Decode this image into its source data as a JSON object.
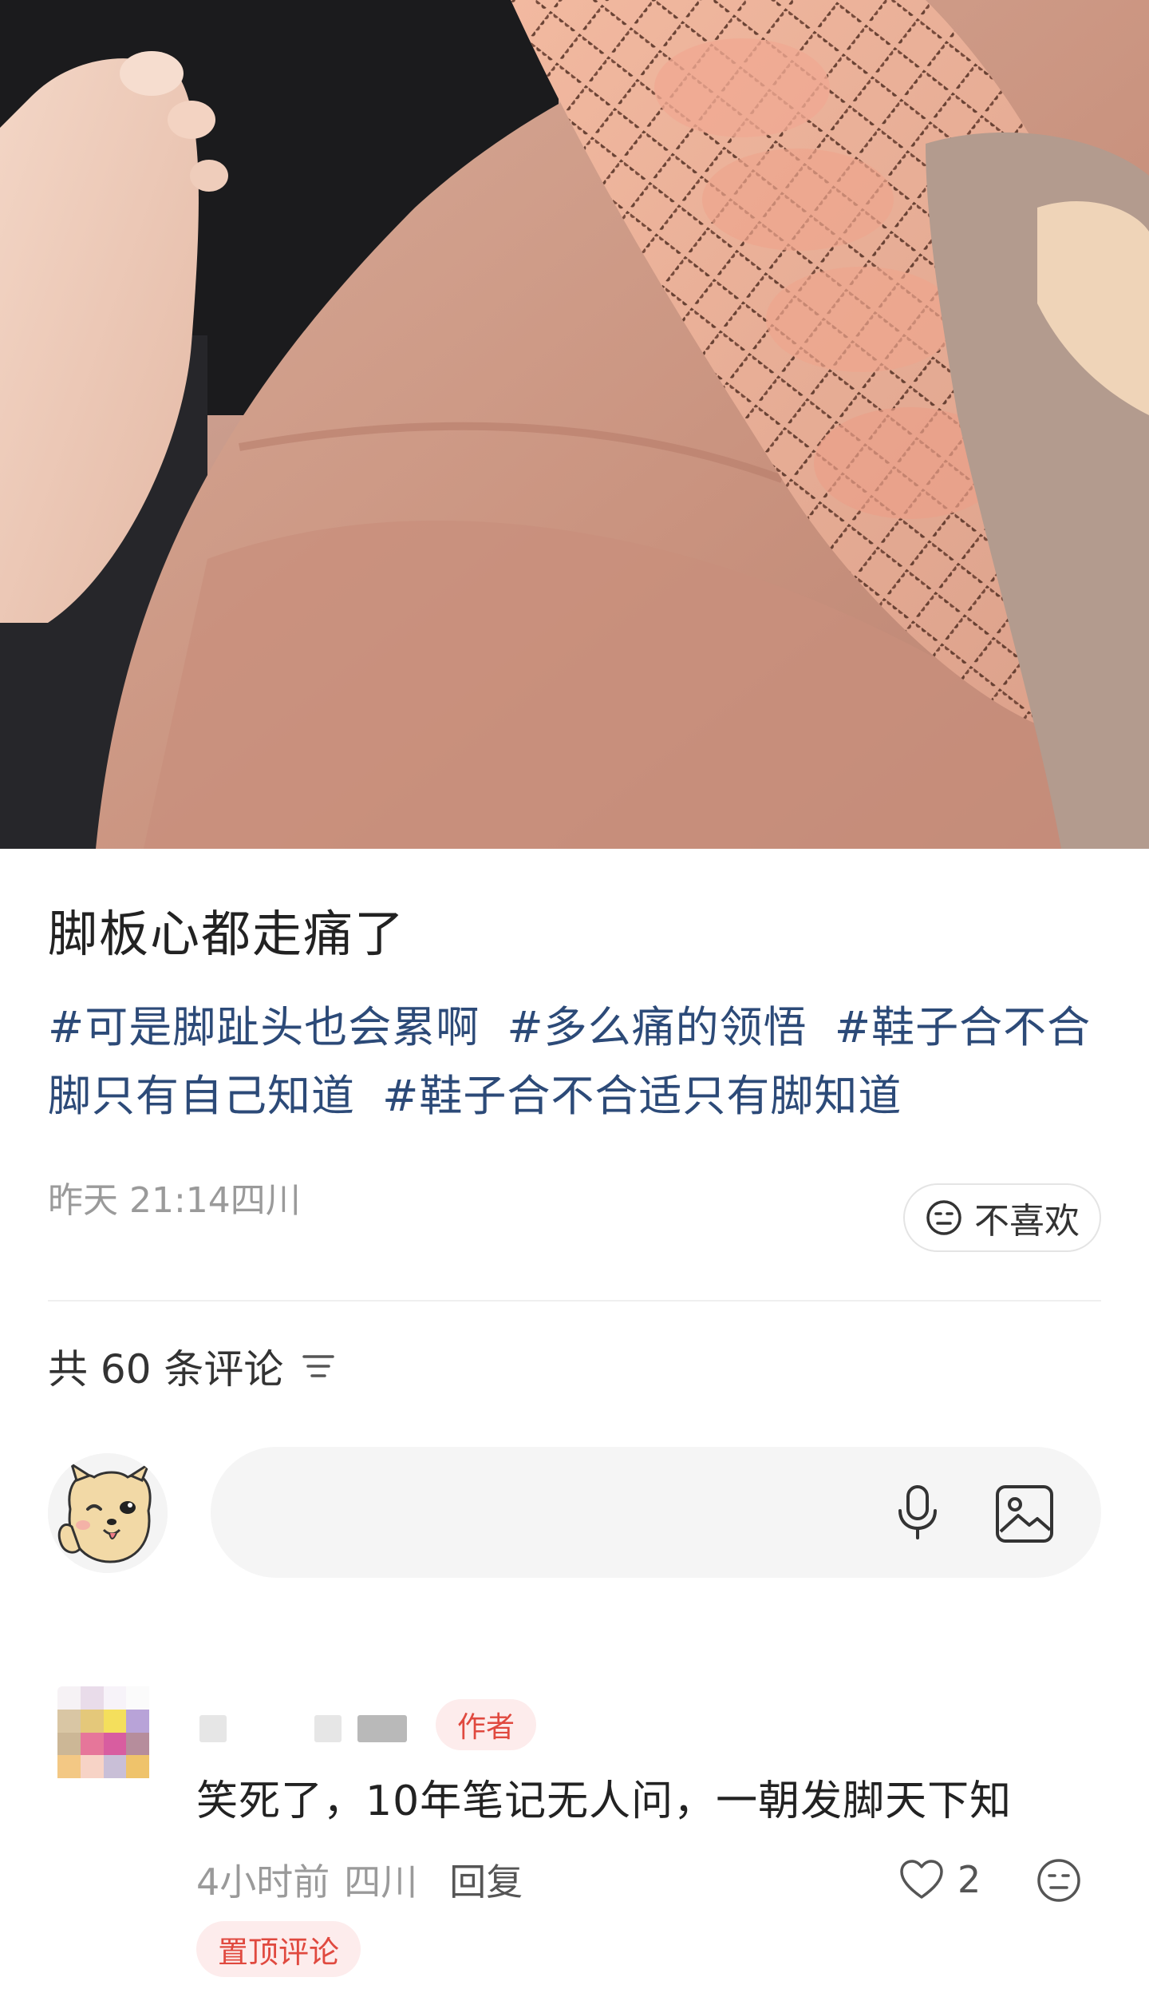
{
  "post": {
    "title": "脚板心都走痛了",
    "tags": [
      "#可是脚趾头也会累啊",
      "#多么痛的领悟",
      "#鞋子合不合脚只有自己知道",
      "#鞋子合不合适只有脚知道"
    ],
    "meta": "昨天 21:14四川",
    "dislike_label": "不喜欢"
  },
  "comments_header": {
    "count_label": "共 60 条评论",
    "sort_icon": "filter-lines-icon"
  },
  "input": {
    "placeholder": "",
    "mic_icon": "microphone-icon",
    "image_icon": "image-icon"
  },
  "comment": {
    "author_tag": "作者",
    "text": "笑死了，10年笔记无人问，一朝发脚天下知",
    "time": "4小时前",
    "location": "四川",
    "reply_label": "回复",
    "likes": "2",
    "pinned_label": "置顶评论"
  },
  "colors": {
    "tag_blue": "#2c4a78",
    "accent_red": "#e0493f",
    "tag_bg": "#fdecec",
    "muted": "#9a9a9a"
  }
}
